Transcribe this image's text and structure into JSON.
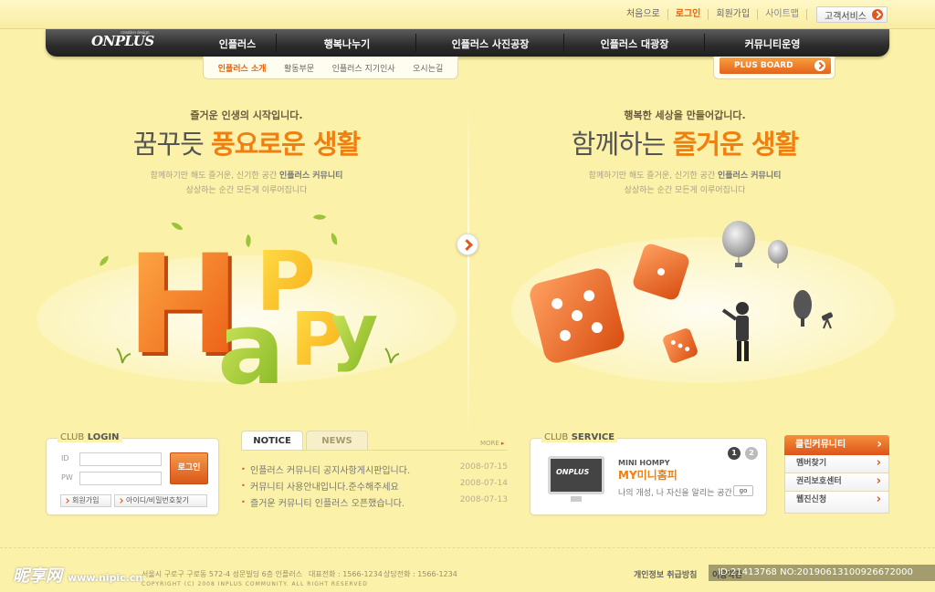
{
  "util": {
    "links": [
      "처음으로",
      "로그인",
      "회원가입",
      "사이트맵"
    ],
    "customer_service": "고객서비스"
  },
  "nav": {
    "logo": "ONPLUS",
    "logo_tag": "creative design",
    "items": [
      "인플러스",
      "행복나누기",
      "인플러스 사진공장",
      "인플러스 대광장",
      "커뮤니티운영"
    ]
  },
  "subnav": {
    "items": [
      "인플러스 소개",
      "활동부문",
      "인플러스 지기인사",
      "오시는길"
    ]
  },
  "plus_board": "PLUS BOARD",
  "hero_left": {
    "small": "즐거운 인생의 시작입니다.",
    "big_plain": "꿈꾸듯 ",
    "big_em": "풍요로운 생활",
    "desc_1": "함께하기만 해도 즐거운, 신기한 공간 ",
    "desc_bold": "인플러스 커뮤니티",
    "desc_2": "상상하는 순간 모든게 이루어집니다",
    "art_letters": [
      "H",
      "a",
      "P",
      "P",
      "y"
    ]
  },
  "hero_right": {
    "small": "행복한 세상을 만들어갑니다.",
    "big_plain": "함께하는 ",
    "big_em": "즐거운 생활",
    "desc_1": "함께하기만 해도 즐거운, 신기한 공간 ",
    "desc_bold": "인플러스 커뮤니티",
    "desc_2": "상상하는 순간 모든게 이루어집니다"
  },
  "login": {
    "title_a": "CLUB",
    "title_b": "LOGIN",
    "id_label": "ID",
    "pw_label": "PW",
    "button": "로그인",
    "join": "회원가입",
    "find": "아이디/비밀번호찾기"
  },
  "notice": {
    "tabs": [
      "NOTICE",
      "NEWS"
    ],
    "more": "MORE",
    "rows": [
      {
        "title": "인플러스 커뮤니티 공지사항게시판입니다.",
        "date": "2008-07-15"
      },
      {
        "title": "커뮤니티 사용안내입니다.준수해주세요",
        "date": "2008-07-14"
      },
      {
        "title": "즐거운 커뮤니티 인플러스 오픈했습니다.",
        "date": "2008-07-13"
      }
    ]
  },
  "service": {
    "title_a": "CLUB",
    "title_b": "SERVICE",
    "pages": [
      "1",
      "2"
    ],
    "kicker": "MINI HOMPY",
    "name": "MY미니홈피",
    "desc": "나의 개성, 나 자신을 알리는 공간!",
    "go": "go"
  },
  "clean": {
    "header": "클린커뮤니티",
    "items": [
      "멤버찾기",
      "권리보호센터",
      "웹진신청"
    ]
  },
  "footer": {
    "address": "서울시 구로구 구로동 572-4 성문빌딩 6층 인플러스",
    "rep_phone": "대표전화 : 1566-1234",
    "counsel_phone": "상담전화 : 1566-1234",
    "copyright": "COPYRIGHT (C) 2008 INPLUS COMMUNITY. ALL RIGHT RESERVED",
    "privacy": "개인정보 취급방침",
    "terms": "이용약관"
  },
  "watermark": {
    "text": "昵享网",
    "url": "www.nipic.cn"
  },
  "id_bar": "ID:21413768 NO:20190613100926672000",
  "colors": {
    "accent": "#f07f10",
    "nav": "#2c2c2c",
    "background": "#fbf1a8"
  }
}
